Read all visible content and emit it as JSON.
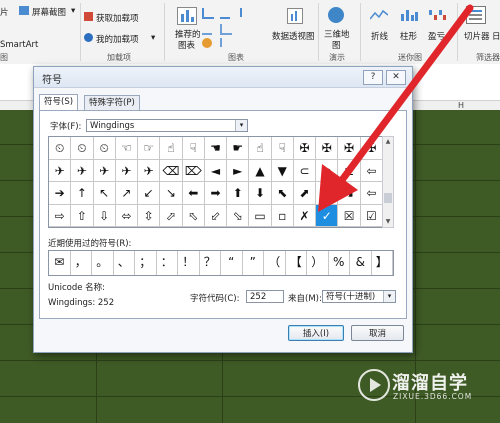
{
  "ribbon": {
    "left_items": [
      "片",
      "SmartArt",
      "图"
    ],
    "screenshot_label": "屏幕截图",
    "get_addins_label": "获取加载项",
    "my_addins_label": "我的加载项",
    "addins_group": "加载项",
    "recommended_charts_line1": "推荐的",
    "recommended_charts_line2": "图表",
    "charts_group": "图表",
    "pivotchart_label": "数据透视图",
    "map3d_line1": "三维地",
    "map3d_line2": "图",
    "tours_group": "演示",
    "line_label": "折线",
    "column_label": "柱形",
    "winloss_label": "盈亏",
    "sparklines_group": "迷你图",
    "slicer_label": "切片器",
    "timeline_label": "日",
    "filters_group": "筛选器"
  },
  "sheet": {
    "column_h": "H"
  },
  "dialog": {
    "title": "符号",
    "help_button": "?",
    "close_button": "✕",
    "tabs": [
      "符号(S)",
      "特殊字符(P)"
    ],
    "font_label": "字体(F):",
    "font_value": "Wingdings",
    "symbols": [
      [
        "⏲",
        "⏲",
        "⏲",
        "☜",
        "☞",
        "☝",
        "☟",
        "☚",
        "☛",
        "☝",
        "☟",
        "✠",
        "✠",
        "✠",
        "✠"
      ],
      [
        "✈",
        "✈",
        "✈",
        "✈",
        "✈",
        "⌫",
        "⌦",
        "◄",
        "►",
        "▲",
        "▼",
        "⊂",
        "⊃",
        "⊏",
        "⇦"
      ],
      [
        "➔",
        "↑",
        "↖",
        "↗",
        "↙",
        "↘",
        "⬅",
        "➡",
        "⬆",
        "⬇",
        "⬉",
        "⬈",
        "⬋",
        "⬊",
        "⇦"
      ],
      [
        "⇨",
        "⇧",
        "⇩",
        "⬄",
        "⇳",
        "⬀",
        "⬁",
        "⬃",
        "⬂",
        "▭",
        "▫",
        "✗",
        "✓",
        "☒",
        "☑"
      ]
    ],
    "selected_symbol": "✓",
    "recent_label": "近期使用过的符号(R):",
    "recent_symbols": [
      "✉",
      "，",
      "。",
      "、",
      "；",
      "：",
      "！",
      "？",
      "“",
      "”",
      "（",
      "【",
      "）",
      "%",
      "&",
      "】"
    ],
    "unicode_name_label": "Unicode 名称:",
    "unicode_name_value": "Wingdings: 252",
    "char_code_label": "字符代码(C):",
    "char_code_value": "252",
    "from_label": "来自(M):",
    "from_value": "符号(十进制)",
    "insert_button": "插入(I)",
    "cancel_button": "取消"
  },
  "watermark": {
    "title": "溜溜自学",
    "url": "ZIXUE.3D66.COM"
  },
  "colors": {
    "sheet_fill": "#3f5b25",
    "selection_blue": "#1e8fe0",
    "arrow_red": "#e0262b"
  }
}
